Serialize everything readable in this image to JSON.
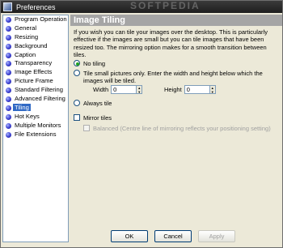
{
  "window": {
    "title": "Preferences",
    "watermark": "SOFTPEDIA"
  },
  "sidebar": {
    "items": [
      {
        "label": "Program Operation"
      },
      {
        "label": "General"
      },
      {
        "label": "Resizing"
      },
      {
        "label": "Background"
      },
      {
        "label": "Caption"
      },
      {
        "label": "Transparency"
      },
      {
        "label": "Image Effects"
      },
      {
        "label": "Picture Frame"
      },
      {
        "label": "Standard Filtering"
      },
      {
        "label": "Advanced Filtering"
      },
      {
        "label": "Tiling",
        "selected": true
      },
      {
        "label": "Hot Keys"
      },
      {
        "label": "Multiple Monitors"
      },
      {
        "label": "File Extensions"
      }
    ]
  },
  "panel": {
    "heading": "Image Tiling",
    "description": "If you wish you can tile your images over the desktop. This is particularly effective if the images are small but you can tile images that have been resized too. The mirroring option makes for a smooth transition between tiles.",
    "options": {
      "no_tiling": "No tiling",
      "tile_small": "Tile small pictures only. Enter the width and height below which the images will be tiled.",
      "always_tile": "Always tile",
      "mirror_tiles": "Mirror tiles",
      "balanced": "Balanced (Centre line of mirroring reflects your positioning setting)"
    },
    "width_label": "Width",
    "width_value": "0",
    "height_label": "Height",
    "height_value": "0"
  },
  "buttons": {
    "ok": "OK",
    "cancel": "Cancel",
    "apply": "Apply"
  }
}
